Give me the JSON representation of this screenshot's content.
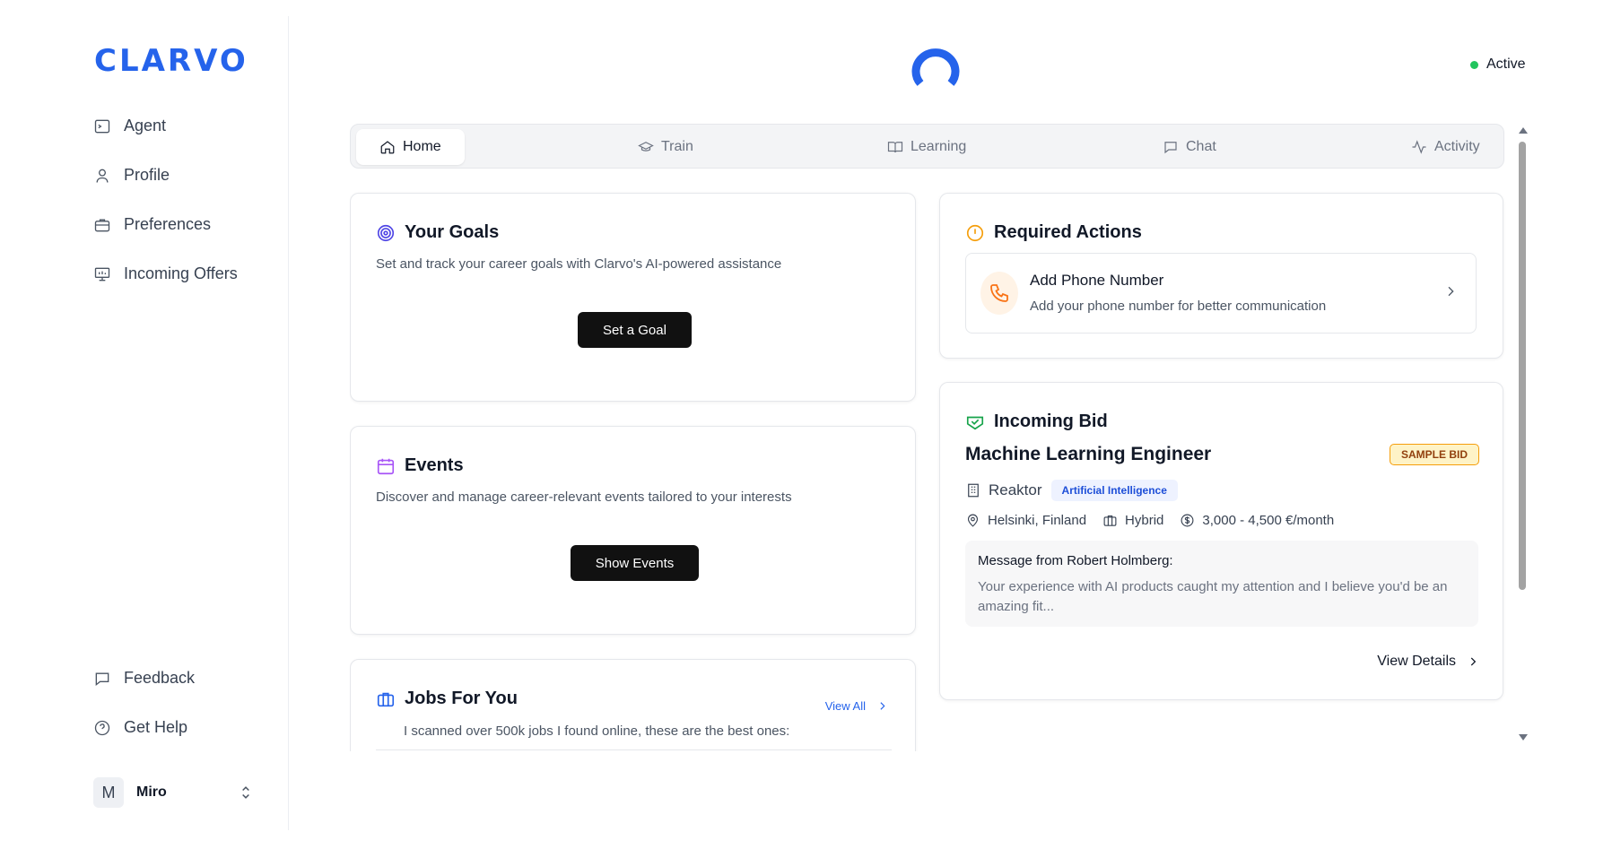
{
  "sidebar": {
    "logo": "CLARVO",
    "items": [
      {
        "label": "Agent",
        "icon": "terminal-icon"
      },
      {
        "label": "Profile",
        "icon": "user-icon"
      },
      {
        "label": "Preferences",
        "icon": "briefcase-icon"
      },
      {
        "label": "Incoming Offers",
        "icon": "presentation-icon"
      }
    ],
    "bottom_items": [
      {
        "label": "Feedback",
        "icon": "message-square-icon"
      },
      {
        "label": "Get Help",
        "icon": "help-circle-icon"
      }
    ],
    "user": {
      "initial": "M",
      "name": "Miro"
    }
  },
  "header": {
    "status_label": "Active",
    "status_color": "#22c55e",
    "brand_color": "#2563eb"
  },
  "tabs": [
    {
      "label": "Home",
      "icon": "home-icon",
      "active": true
    },
    {
      "label": "Train",
      "icon": "graduation-cap-icon",
      "active": false
    },
    {
      "label": "Learning",
      "icon": "book-open-icon",
      "active": false
    },
    {
      "label": "Chat",
      "icon": "chat-icon",
      "active": false
    },
    {
      "label": "Activity",
      "icon": "activity-icon",
      "active": false
    }
  ],
  "goals": {
    "title": "Your Goals",
    "description": "Set and track your career goals with Clarvo's AI-powered assistance",
    "button": "Set a Goal"
  },
  "events": {
    "title": "Events",
    "description": "Discover and manage career-relevant events tailored to your interests",
    "button": "Show Events"
  },
  "jobs": {
    "title": "Jobs For You",
    "view_all": "View All",
    "description": "I scanned over 500k jobs I found online, these are the best ones:"
  },
  "required_actions": {
    "title": "Required Actions",
    "items": [
      {
        "title": "Add Phone Number",
        "subtitle": "Add your phone number for better communication"
      }
    ]
  },
  "incoming_bid": {
    "title": "Incoming Bid",
    "role": "Machine Learning Engineer",
    "badge": "SAMPLE BID",
    "company": "Reaktor",
    "category": "Artificial Intelligence",
    "location": "Helsinki, Finland",
    "work_mode": "Hybrid",
    "salary": "3,000 - 4,500 €/month",
    "message_from": "Message from Robert Holmberg:",
    "message": "Your experience with AI products caught my attention and I believe you'd be an amazing fit...",
    "view_details": "View Details"
  }
}
